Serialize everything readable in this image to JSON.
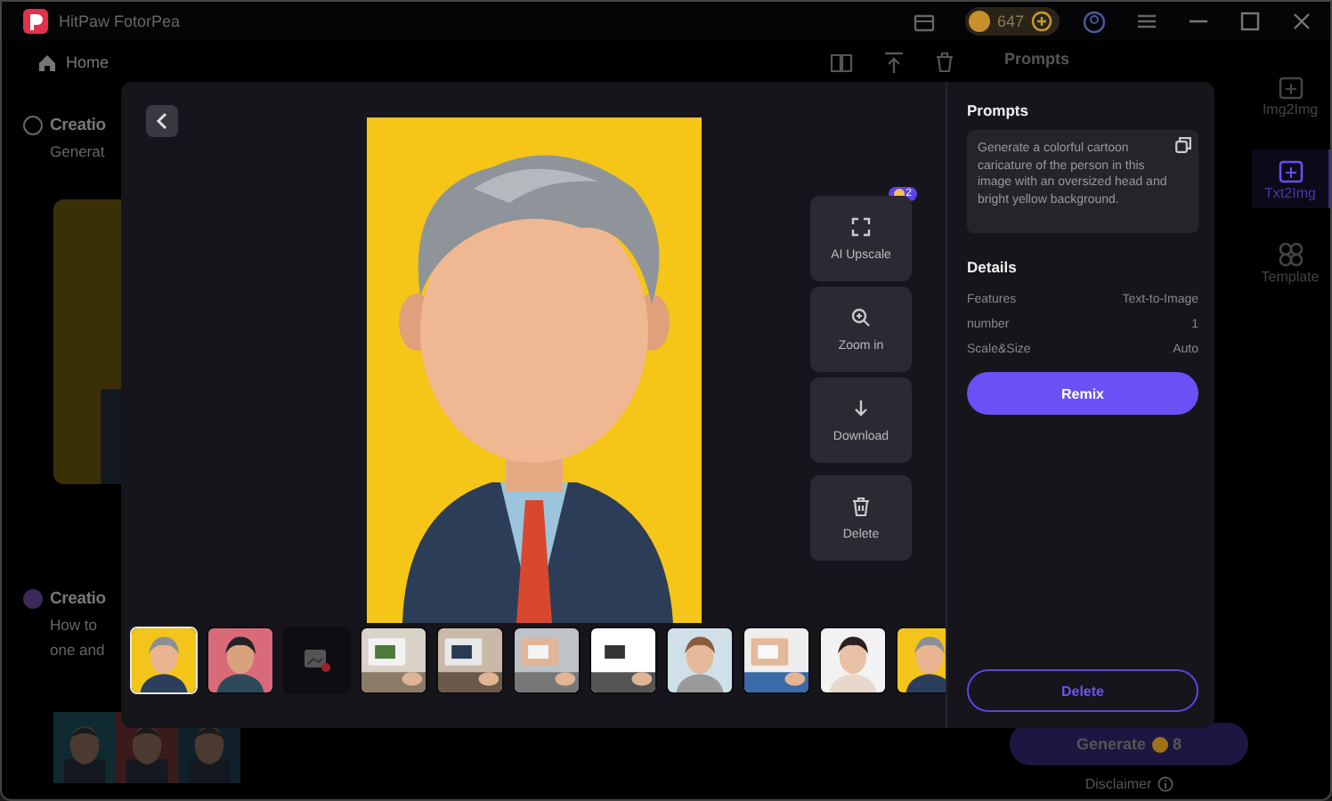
{
  "app": {
    "title": "HitPaw FotorPea",
    "coins": "647"
  },
  "nav": {
    "home": "Home"
  },
  "background": {
    "sections": [
      {
        "title": "Creatio",
        "lines": [
          "Generat"
        ],
        "pictures": [
          {
            "kind": "picture"
          }
        ]
      },
      {
        "title": "Creatio",
        "lines": [
          "How to",
          "one and"
        ],
        "pictures": [
          {
            "kind": "picture"
          },
          {
            "kind": "picture"
          },
          {
            "kind": "picture"
          }
        ]
      }
    ],
    "panel_title": "Prompts",
    "sidebar": [
      {
        "label": "Img2Img",
        "selected": false
      },
      {
        "label": "Txt2Img",
        "selected": true
      },
      {
        "label": "Template",
        "selected": false
      }
    ],
    "generate": {
      "label": "Generate",
      "cost": "8"
    },
    "disclaimer": "Disclaimer"
  },
  "viewer": {
    "actions": [
      {
        "kind": "upscale",
        "label": "AI Upscale",
        "badge": "2"
      },
      {
        "kind": "zoom",
        "label": "Zoom in"
      },
      {
        "kind": "download",
        "label": "Download"
      },
      {
        "kind": "delete",
        "label": "Delete"
      }
    ],
    "thumbnails": [
      {
        "kind": "picture",
        "selected": true
      },
      {
        "kind": "picture",
        "selected": false
      },
      {
        "kind": "empty",
        "selected": false
      },
      {
        "kind": "picture",
        "selected": false
      },
      {
        "kind": "picture",
        "selected": false
      },
      {
        "kind": "picture",
        "selected": false
      },
      {
        "kind": "picture",
        "selected": false
      },
      {
        "kind": "picture",
        "selected": false
      },
      {
        "kind": "picture",
        "selected": false
      },
      {
        "kind": "picture",
        "selected": false
      },
      {
        "kind": "picture",
        "selected": false
      }
    ],
    "prompts_title": "Prompts",
    "prompt": "Generate a colorful cartoon caricature of the person in this image with an oversized head and bright yellow background.",
    "details_title": "Details",
    "details": [
      {
        "label": "Features",
        "value": "Text-to-Image"
      },
      {
        "label": "number",
        "value": "1"
      },
      {
        "label": "Scale&Size",
        "value": "Auto"
      }
    ],
    "remix": "Remix",
    "delete": "Delete"
  }
}
